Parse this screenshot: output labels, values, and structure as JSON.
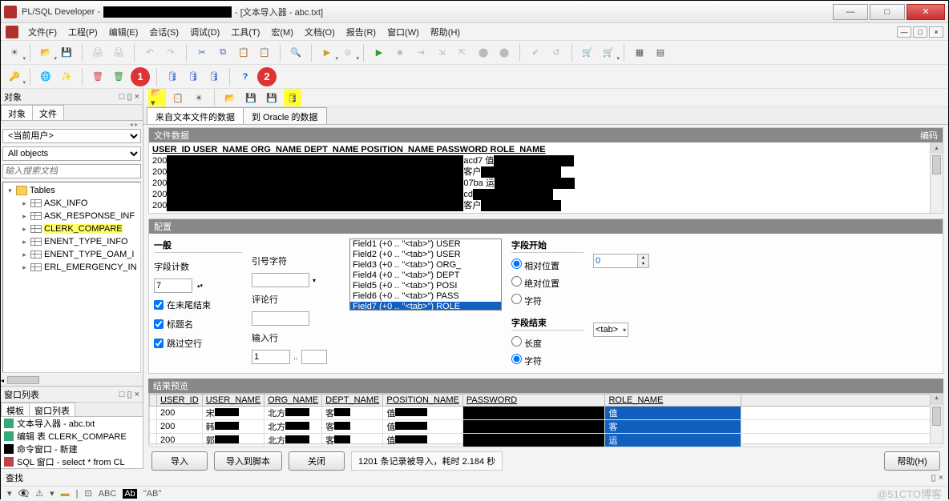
{
  "title": {
    "app": "PL/SQL Developer -",
    "suffix": "- [文本导入器 - abc.txt]"
  },
  "winbtns": {
    "min": "—",
    "max": "□",
    "close": "✕"
  },
  "menu": [
    "文件(F)",
    "工程(P)",
    "编辑(E)",
    "会话(S)",
    "调试(D)",
    "工具(T)",
    "宏(M)",
    "文档(O)",
    "报告(R)",
    "窗口(W)",
    "帮助(H)"
  ],
  "mdibtns": [
    "—",
    "□",
    "×"
  ],
  "badges": {
    "one": "1",
    "two": "2"
  },
  "left": {
    "panel": "对象",
    "tabs": [
      "对象",
      "文件"
    ],
    "userCombo": "<当前用户>",
    "filterCombo": "All objects",
    "search": "输入搜索文档",
    "tablesGroup": "Tables",
    "tables": [
      "ASK_INFO",
      "ASK_RESPONSE_INF",
      "CLERK_COMPARE",
      "ENENT_TYPE_INFO",
      "ENENT_TYPE_OAM_I",
      "ERL_EMERGENCY_IN"
    ],
    "wlPanel": "窗口列表",
    "wlTabs": [
      "模板",
      "窗口列表"
    ],
    "wlItems": [
      "文本导入器 - abc.txt",
      "编辑 表 CLERK_COMPARE",
      "命令窗口 - 新建",
      "SQL 窗口 - select * from CL"
    ]
  },
  "importer": {
    "tabs": [
      "来自文本文件的数据",
      "到 Oracle 的数据"
    ],
    "fileSection": "文件数据",
    "encoding": "编码",
    "headerLine": "USER_ID USER_NAME ORG_NAME DEPT_NAME POSITION_NAME PASSWORD ROLE_NAME",
    "rowid": "200",
    "suffixes": [
      "acd7 值",
      "客户",
      "07ba 运",
      "cd",
      "客户",
      "客户"
    ],
    "config": {
      "title": "配置",
      "general": "一般",
      "fieldCount": "字段计数",
      "fieldCountVal": "7",
      "endAtTail": "在末尾结束",
      "headerName": "标题名",
      "skipBlank": "跳过空行",
      "quoteChar": "引号字符",
      "commentLine": "评论行",
      "inputLine": "输入行",
      "inputLineVal": "1",
      "fields": [
        "Field1   (+0 .. \"<tab>\")   USER",
        "Field2   (+0 .. \"<tab>\")   USER",
        "Field3   (+0 .. \"<tab>\")   ORG_",
        "Field4   (+0 .. \"<tab>\")   DEPT",
        "Field5   (+0 .. \"<tab>\")   POSI",
        "Field6   (+0 .. \"<tab>\")   PASS",
        "Field7   (+0 .. \"<tab>\")   ROLE"
      ],
      "fieldStart": "字段开始",
      "relPos": "相对位置",
      "absPos": "绝对位置",
      "charPos": "字符",
      "startVal": "0",
      "fieldEnd": "字段结束",
      "length": "长度",
      "charEnd": "字符",
      "endVal": "<tab>"
    },
    "preview": {
      "title": "结果预览",
      "cols": [
        "USER_ID",
        "USER_NAME",
        "ORG_NAME",
        "DEPT_NAME",
        "POSITION_NAME",
        "PASSWORD",
        "ROLE_NAME"
      ],
      "ids": [
        "200",
        "200",
        "200"
      ],
      "names": [
        "宋",
        "韩",
        "郭"
      ],
      "org": "北方",
      "dept": "客",
      "pos": "值",
      "role": [
        "值",
        "客",
        "运"
      ]
    },
    "buttons": {
      "import": "导入",
      "importScript": "导入到脚本",
      "close": "关闭",
      "help": "帮助(H)"
    },
    "status": "1201 条记录被导入，耗时 2.184 秒"
  },
  "find": {
    "label": "查找"
  },
  "watermark": "@51CTO博客"
}
